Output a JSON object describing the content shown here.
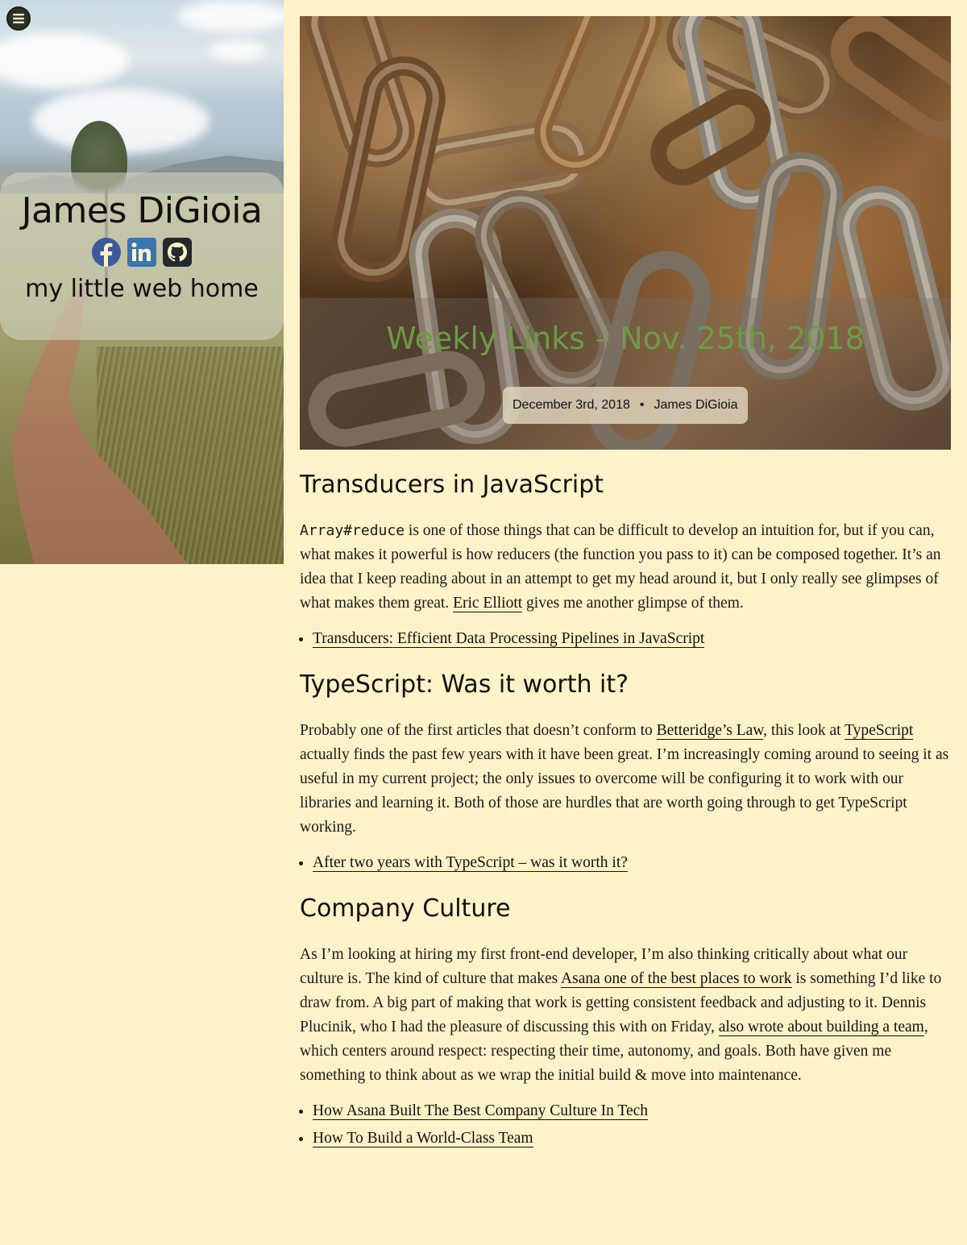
{
  "sidebar": {
    "menu_icon": "hamburger-menu-icon",
    "site_name": "James DiGioia",
    "tagline": "my little web home",
    "social": [
      {
        "name": "facebook-icon",
        "color": "#3b5a99"
      },
      {
        "name": "linkedin-icon",
        "color": "#3b75b0"
      },
      {
        "name": "github-icon",
        "color": "#24292e"
      }
    ]
  },
  "post": {
    "title": "Weekly Links – Nov. 25th, 2018",
    "date": "December 3rd, 2018",
    "separator": "•",
    "author": "James DiGioia",
    "title_color": "#6c9b45"
  },
  "sections": [
    {
      "heading": "Transducers in JavaScript",
      "code": "Array#reduce",
      "p1": " is one of those things that can be difficult to develop an intuition for, but if you can, what makes it powerful is how reducers (the function you pass to it) can be composed together. It’s an idea that I keep reading about in an attempt to get my head around it, but I only really see glimpses of what makes them great. ",
      "link1": "Eric Elliott",
      "p2": " gives me another glimpse of them.",
      "links": [
        "Transducers: Efficient Data Processing Pipelines in JavaScript"
      ]
    },
    {
      "heading": "TypeScript: Was it worth it?",
      "p1": "Probably one of the first articles that doesn’t conform to ",
      "link1": "Betteridge’s Law",
      "p2": ", this look at ",
      "link2": "TypeScript",
      "p3": " actually finds the past few years with it have been great. I’m increasingly coming around to seeing it as useful in my current project; the only issues to overcome will be configuring it to work with our libraries and learning it. Both of those are hurdles that are worth going through to get TypeScript working.",
      "links": [
        "After two years with TypeScript – was it worth it?"
      ]
    },
    {
      "heading": "Company Culture",
      "p1": "As I’m looking at hiring my first front-end developer, I’m also thinking critically about what our culture is. The kind of culture that makes ",
      "link1": "Asana one of the best places to work",
      "p2": " is something I’d like to draw from. A big part of making that work is getting consistent feedback and adjusting to it. Dennis Plucinik, who I had the pleasure of discussing this with on Friday, ",
      "link2": "also wrote about building a team",
      "p3": ", which centers around respect: respecting their time, autonomy, and goals. Both have given me something to think about as we wrap the initial build & move into maintenance.",
      "links": [
        "How Asana Built The Best Company Culture In Tech",
        "How To Build a World-Class Team"
      ]
    }
  ]
}
